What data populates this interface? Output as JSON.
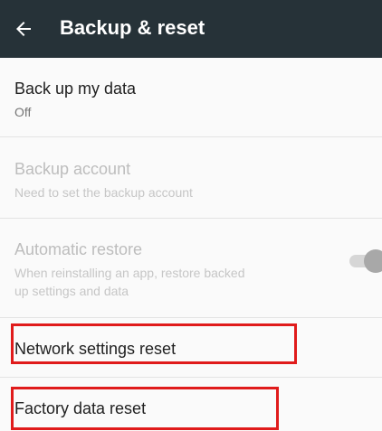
{
  "toolbar": {
    "title": "Backup & reset",
    "back_icon": "arrow-back-icon"
  },
  "items": [
    {
      "title": "Back up my data",
      "subtitle": "Off",
      "enabled": true
    },
    {
      "title": "Backup account",
      "subtitle": "Need to set the backup account",
      "enabled": false
    },
    {
      "title": "Automatic restore",
      "subtitle_line1": "When reinstalling an app, restore backed",
      "subtitle_line2": "up settings and data",
      "enabled": false,
      "toggle_on": true
    },
    {
      "title": "Network settings reset",
      "enabled": true
    },
    {
      "title": "Factory data reset",
      "enabled": true
    }
  ],
  "colors": {
    "toolbar": "#263238",
    "background": "#fafafa",
    "highlight": "#e01b1b"
  }
}
